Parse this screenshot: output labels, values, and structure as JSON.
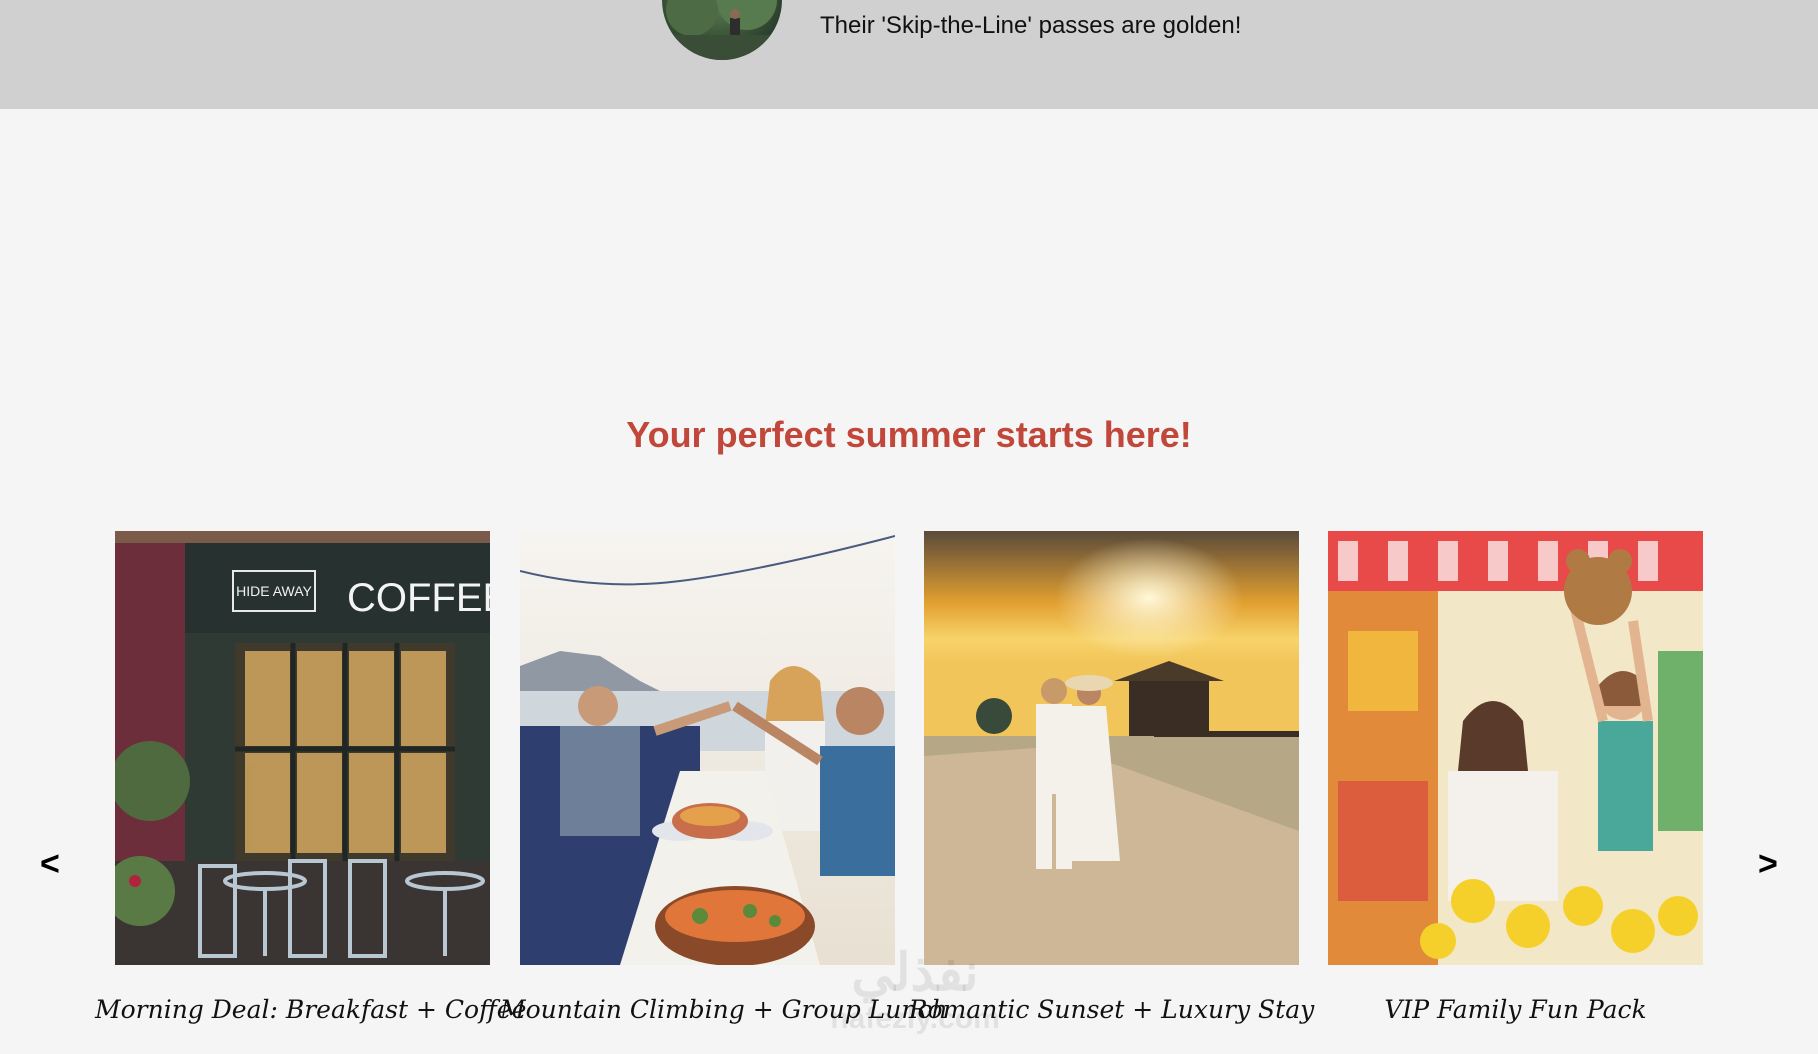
{
  "testimonial": {
    "quote": "Their 'Skip-the-Line' passes are golden!"
  },
  "section": {
    "title": "Your perfect summer starts here!"
  },
  "carousel": {
    "prev_label": "<",
    "next_label": ">",
    "items": [
      {
        "caption": "Morning Deal: Breakfast + Coffee",
        "sign_text": "COFFEE",
        "logo_text": "HIDE AWAY"
      },
      {
        "caption": "Mountain Climbing + Group Lunch"
      },
      {
        "caption": "Romantic Sunset + Luxury Stay"
      },
      {
        "caption": "VIP Family Fun Pack"
      }
    ]
  },
  "watermark": {
    "arabic": "نفذلي",
    "latin": "nafezly.com"
  },
  "colors": {
    "accent": "#c0473a",
    "band": "#d0d0d0",
    "page_bg": "#f5f5f5"
  }
}
